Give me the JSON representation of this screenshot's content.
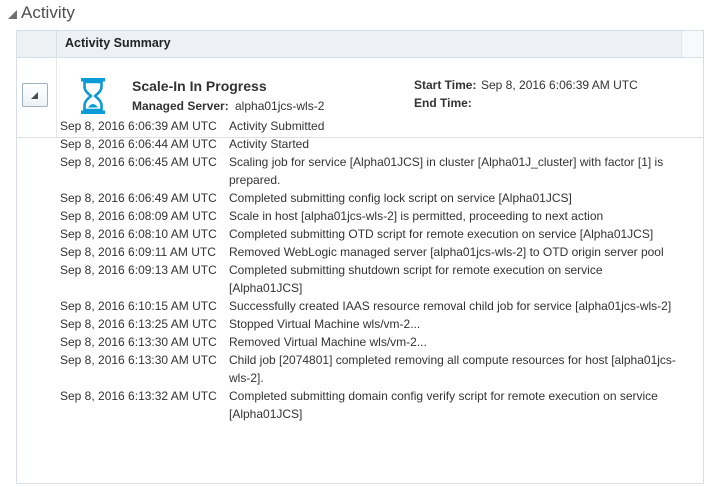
{
  "section": {
    "title": "Activity"
  },
  "panel": {
    "header": "Activity Summary"
  },
  "summary": {
    "status": "Scale-In In Progress",
    "managed_server_label": "Managed Server:",
    "managed_server_value": "alpha01jcs-wls-2",
    "start_time_label": "Start Time:",
    "start_time_value": "Sep 8, 2016 6:06:39 AM UTC",
    "end_time_label": "End Time:",
    "end_time_value": "",
    "status_icon": "hourglass-icon",
    "accent_color": "#0a9ad5"
  },
  "log": [
    {
      "time": "Sep 8, 2016 6:06:39 AM UTC",
      "message": "Activity Submitted"
    },
    {
      "time": "Sep 8, 2016 6:06:44 AM UTC",
      "message": "Activity Started"
    },
    {
      "time": "Sep 8, 2016 6:06:45 AM UTC",
      "message": "Scaling job for service [Alpha01JCS] in cluster [Alpha01J_cluster] with factor [1] is prepared."
    },
    {
      "time": "Sep 8, 2016 6:06:49 AM UTC",
      "message": "Completed submitting config lock script on service [Alpha01JCS]"
    },
    {
      "time": "Sep 8, 2016 6:08:09 AM UTC",
      "message": "Scale in host [alpha01jcs-wls-2] is permitted, proceeding to next action"
    },
    {
      "time": "Sep 8, 2016 6:08:10 AM UTC",
      "message": "Completed submitting OTD script for remote execution on service [Alpha01JCS]"
    },
    {
      "time": "Sep 8, 2016 6:09:11 AM UTC",
      "message": "Removed WebLogic managed server [alpha01jcs-wls-2] to OTD origin server pool"
    },
    {
      "time": "Sep 8, 2016 6:09:13 AM UTC",
      "message": "Completed submitting shutdown script for remote execution on service [Alpha01JCS]"
    },
    {
      "time": "Sep 8, 2016 6:10:15 AM UTC",
      "message": "Successfully created IAAS resource removal child job for service [alpha01jcs-wls-2]"
    },
    {
      "time": "Sep 8, 2016 6:13:25 AM UTC",
      "message": "Stopped Virtual Machine wls/vm-2..."
    },
    {
      "time": "Sep 8, 2016 6:13:30 AM UTC",
      "message": "Removed Virtual Machine wls/vm-2..."
    },
    {
      "time": "Sep 8, 2016 6:13:30 AM UTC",
      "message": "Child job [2074801] completed removing all compute resources for host [alpha01jcs-wls-2]."
    },
    {
      "time": "Sep 8, 2016 6:13:32 AM UTC",
      "message": "Completed submitting domain config verify script for remote execution on service [Alpha01JCS]"
    }
  ]
}
